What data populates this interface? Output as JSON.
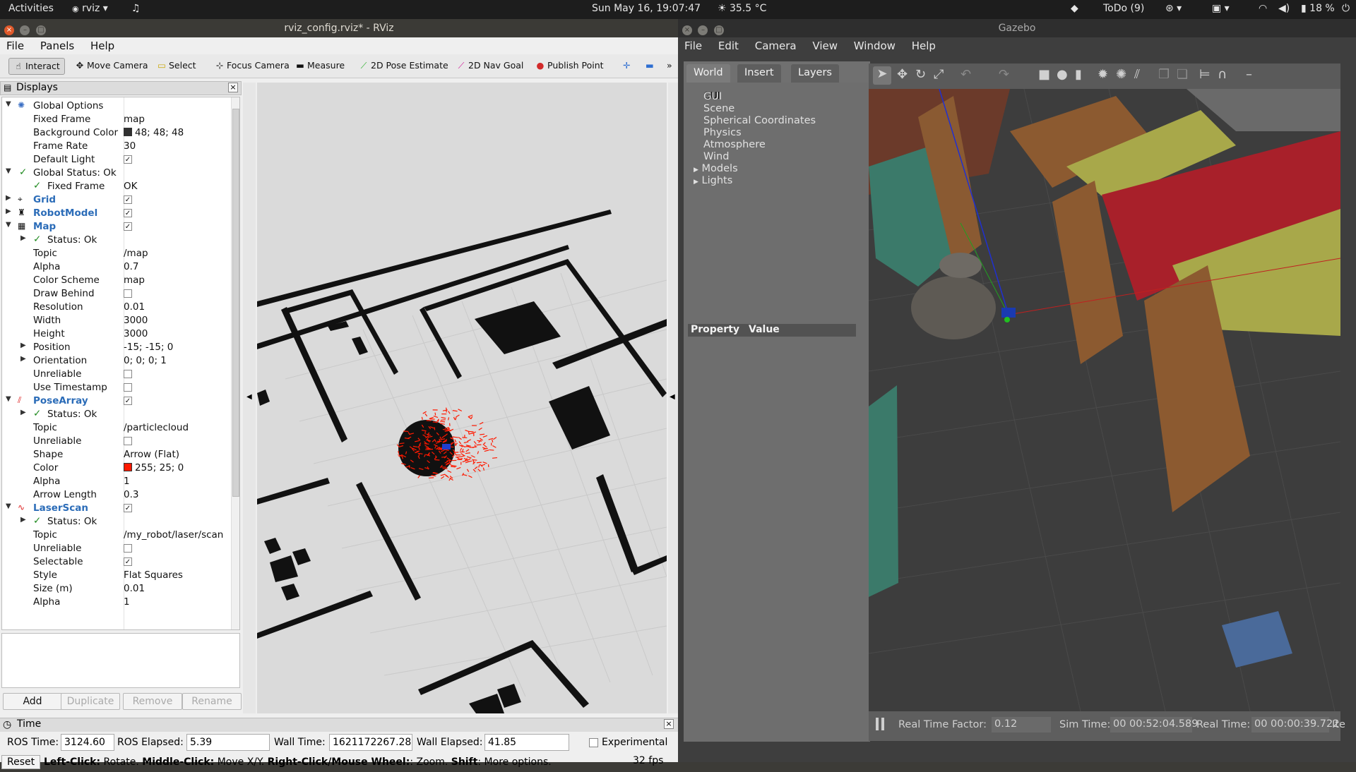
{
  "topbar": {
    "activities": "Activities",
    "app": "rviz ▾",
    "clock": "Sun May 16, 19:07:47",
    "weather": "35.5 °C",
    "todo": "ToDo (9)",
    "battery": "18 %"
  },
  "rviz": {
    "title": "rviz_config.rviz* - RViz",
    "menu": [
      "File",
      "Panels",
      "Help"
    ],
    "tools": {
      "interact": "Interact",
      "move_camera": "Move Camera",
      "select": "Select",
      "focus_camera": "Focus Camera",
      "measure": "Measure",
      "pose_estimate": "2D Pose Estimate",
      "nav_goal": "2D Nav Goal",
      "publish_point": "Publish Point"
    },
    "displays_title": "Displays",
    "tree": {
      "global_options": "Global Options",
      "fixed_frame_label": "Fixed Frame",
      "fixed_frame_val": "map",
      "bg_color_label": "Background Color",
      "bg_color_val": "48; 48; 48",
      "frame_rate_label": "Frame Rate",
      "frame_rate_val": "30",
      "default_light_label": "Default Light",
      "global_status": "Global Status: Ok",
      "gs_fixed_frame": "Fixed Frame",
      "gs_fixed_frame_val": "OK",
      "grid": "Grid",
      "robot_model": "RobotModel",
      "map": "Map",
      "map_status": "Status: Ok",
      "topic_label": "Topic",
      "map_topic": "/map",
      "alpha_label": "Alpha",
      "map_alpha": "0.7",
      "color_scheme_label": "Color Scheme",
      "map_color_scheme": "map",
      "draw_behind_label": "Draw Behind",
      "resolution_label": "Resolution",
      "map_resolution": "0.01",
      "width_label": "Width",
      "map_width": "3000",
      "height_label": "Height",
      "map_height": "3000",
      "position_label": "Position",
      "map_position": "-15; -15; 0",
      "orientation_label": "Orientation",
      "map_orientation": "0; 0; 0; 1",
      "unreliable_label": "Unreliable",
      "use_timestamp_label": "Use Timestamp",
      "pose_array": "PoseArray",
      "pa_status": "Status: Ok",
      "pa_topic": "/particlecloud",
      "shape_label": "Shape",
      "pa_shape": "Arrow (Flat)",
      "color_label": "Color",
      "pa_color": "255; 25; 0",
      "pa_alpha": "1",
      "arrow_length_label": "Arrow Length",
      "pa_arrow_length": "0.3",
      "laser_scan": "LaserScan",
      "ls_status": "Status: Ok",
      "ls_topic": "/my_robot/laser/scan",
      "selectable_label": "Selectable",
      "style_label": "Style",
      "ls_style": "Flat Squares",
      "size_label": "Size (m)",
      "ls_size": "0.01",
      "ls_alpha": "1"
    },
    "buttons": {
      "add": "Add",
      "duplicate": "Duplicate",
      "remove": "Remove",
      "rename": "Rename"
    },
    "time": {
      "title": "Time",
      "ros_time_label": "ROS Time:",
      "ros_time": "3124.60",
      "ros_elapsed_label": "ROS Elapsed:",
      "ros_elapsed": "5.39",
      "wall_time_label": "Wall Time:",
      "wall_time": "1621172267.28",
      "wall_elapsed_label": "Wall Elapsed:",
      "wall_elapsed": "41.85",
      "experimental": "Experimental"
    },
    "status": {
      "reset": "Reset",
      "left_click": "Left-Click:",
      "left_click_text": " Rotate. ",
      "middle_click": "Middle-Click:",
      "middle_click_text": " Move X/Y. ",
      "right_click": "Right-Click/Mouse Wheel:",
      "right_click_text": ": Zoom. ",
      "shift": "Shift",
      "shift_text": ": More options.",
      "fps": "32 fps"
    },
    "colors": {
      "particles": "#ff1900",
      "background": "#303030",
      "map_free": "#d8d8d8"
    }
  },
  "gazebo": {
    "title": "Gazebo",
    "menu": [
      "File",
      "Edit",
      "Camera",
      "View",
      "Window",
      "Help"
    ],
    "tabs": [
      "World",
      "Insert",
      "Layers"
    ],
    "tree": [
      "GUI",
      "Scene",
      "Spherical Coordinates",
      "Physics",
      "Atmosphere",
      "Wind",
      "Models",
      "Lights"
    ],
    "property_header": "Property",
    "value_header": "Value",
    "bottom": {
      "rtf_label": "Real Time Factor:",
      "rtf": "0.12",
      "sim_time_label": "Sim Time:",
      "sim_time": "00 00:52:04.589",
      "real_time_label": "Real Time:",
      "real_time": "00 00:00:39.722",
      "iter_label": "Ite"
    }
  }
}
